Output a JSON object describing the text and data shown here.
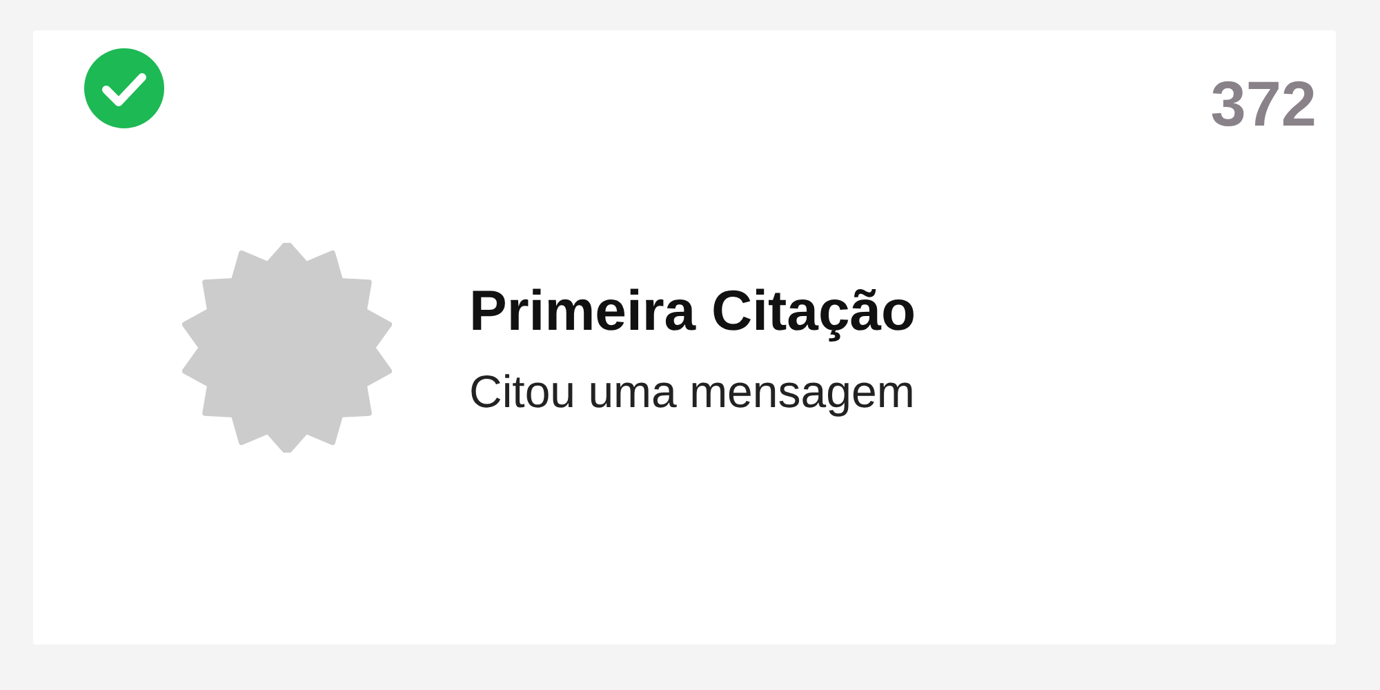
{
  "badge": {
    "earned": true,
    "count": "372",
    "title": "Primeira Citação",
    "description": "Citou uma mensagem"
  }
}
